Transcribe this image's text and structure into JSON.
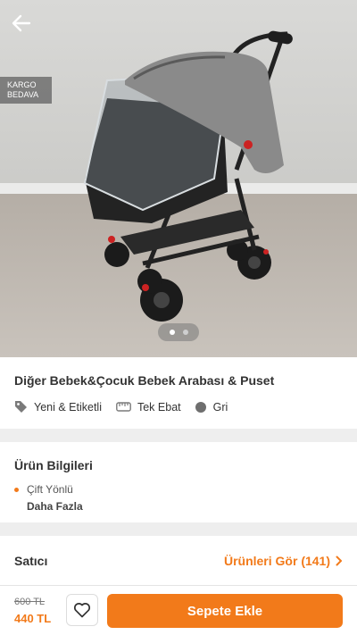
{
  "hero": {
    "badge_line1": "KARGO",
    "badge_line2": "BEDAVA",
    "image_alt": "stroller-photo",
    "slide_count": 2,
    "active_slide": 1
  },
  "product": {
    "title": "Diğer Bebek&Çocuk Bebek Arabası & Puset",
    "attributes": [
      {
        "label": "Yeni & Etiketli",
        "icon": "tag-icon"
      },
      {
        "label": "Tek Ebat",
        "icon": "ruler-icon"
      },
      {
        "label": "Gri",
        "icon": "color-swatch-icon"
      }
    ]
  },
  "info": {
    "title": "Ürün Bilgileri",
    "items": [
      "Çift Yönlü"
    ],
    "more_label": "Daha Fazla"
  },
  "seller": {
    "label": "Satıcı",
    "link_label": "Ürünleri Gör (141)"
  },
  "bottom_bar": {
    "old_price": "600 TL",
    "new_price": "440 TL",
    "cart_label": "Sepete Ekle"
  },
  "colors": {
    "accent": "#f27a1a",
    "swatch": "#6e6e6e"
  }
}
